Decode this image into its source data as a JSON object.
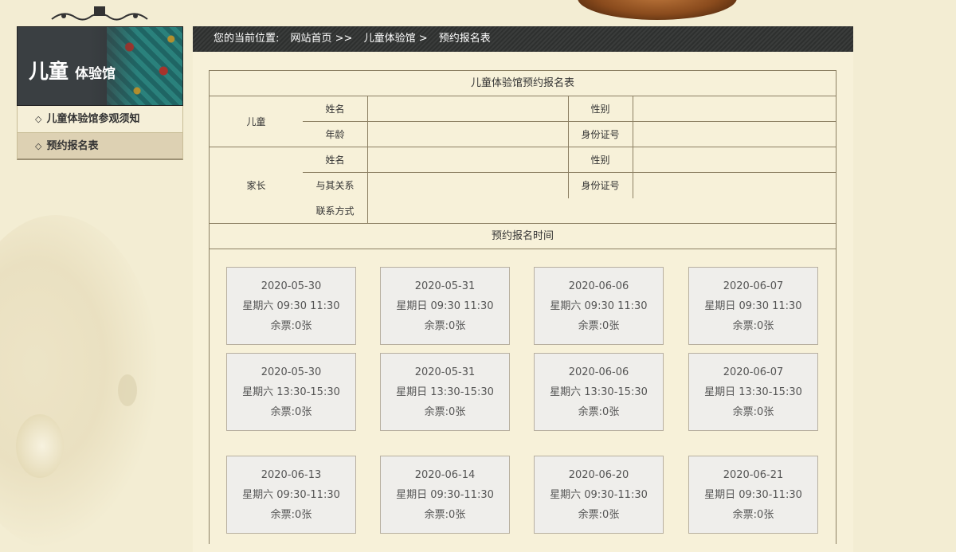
{
  "sidebar": {
    "banner_title_big": "儿童",
    "banner_title_small": "体验馆",
    "items": [
      {
        "label": "儿童体验馆参观须知",
        "active": false
      },
      {
        "label": "预约报名表",
        "active": true
      }
    ]
  },
  "breadcrumb": {
    "prefix": "您的当前位置:",
    "home": "网站首页 >>",
    "section": "儿童体验馆 >",
    "current": "预约报名表"
  },
  "form": {
    "title": "儿童体验馆预约报名表",
    "child_label": "儿童",
    "child_fields": {
      "name": "姓名",
      "gender": "性别",
      "age": "年龄",
      "id": "身份证号"
    },
    "parent_label": "家长",
    "parent_fields": {
      "name": "姓名",
      "gender": "性别",
      "relation": "与其关系",
      "id": "身份证号",
      "contact": "联系方式"
    },
    "time_title": "预约报名时间"
  },
  "slots": [
    {
      "date": "2020-05-30",
      "time": "星期六 09:30 11:30",
      "tickets": "余票:0张"
    },
    {
      "date": "2020-05-31",
      "time": "星期日 09:30 11:30",
      "tickets": "余票:0张"
    },
    {
      "date": "2020-06-06",
      "time": "星期六 09:30 11:30",
      "tickets": "余票:0张"
    },
    {
      "date": "2020-06-07",
      "time": "星期日 09:30 11:30",
      "tickets": "余票:0张"
    },
    {
      "date": "2020-05-30",
      "time": "星期六 13:30-15:30",
      "tickets": "余票:0张"
    },
    {
      "date": "2020-05-31",
      "time": "星期日 13:30-15:30",
      "tickets": "余票:0张"
    },
    {
      "date": "2020-06-06",
      "time": "星期六 13:30-15:30",
      "tickets": "余票:0张"
    },
    {
      "date": "2020-06-07",
      "time": "星期日 13:30-15:30",
      "tickets": "余票:0张"
    },
    {
      "date": "2020-06-13",
      "time": "星期六 09:30-11:30",
      "tickets": "余票:0张"
    },
    {
      "date": "2020-06-14",
      "time": "星期日 09:30-11:30",
      "tickets": "余票:0张"
    },
    {
      "date": "2020-06-20",
      "time": "星期六 09:30-11:30",
      "tickets": "余票:0张"
    },
    {
      "date": "2020-06-21",
      "time": "星期日 09:30-11:30",
      "tickets": "余票:0张"
    }
  ]
}
